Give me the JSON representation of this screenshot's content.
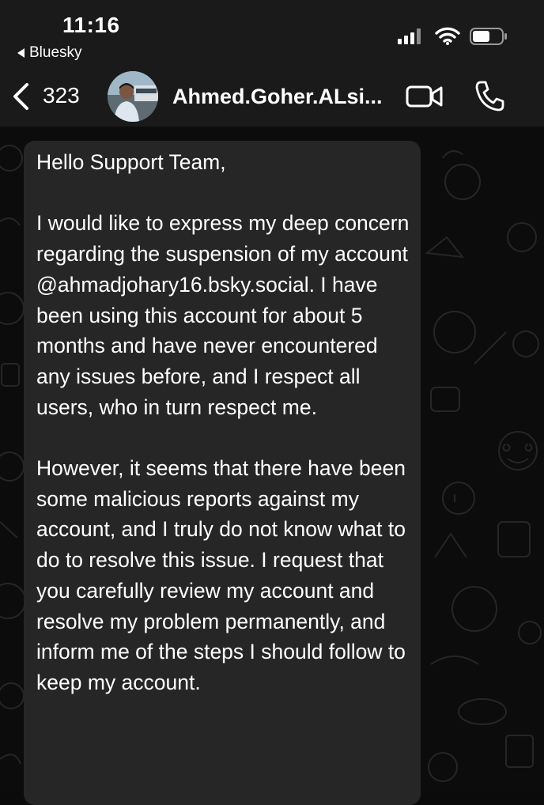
{
  "status_bar": {
    "time": "11:16",
    "back_app": "Bluesky",
    "icons": [
      "signal-bars-icon",
      "wifi-icon",
      "battery-icon"
    ]
  },
  "header": {
    "back_icon": "chevron-left-icon",
    "unread_count": "323",
    "contact_name": "Ahmed.Goher.ALsi...",
    "actions": [
      "video-call-icon",
      "phone-call-icon"
    ]
  },
  "message": {
    "greeting": "Hello Support Team,",
    "paragraph1": "I would like to express my deep concern regarding the suspension of my account @ahmadjohary16.bsky.social. I have been using this account for about 5 months and have never encountered any issues before, and I respect all users, who in turn respect me.",
    "paragraph2": "However, it seems that there have been some malicious reports against my account, and I truly do not know what to do to resolve this issue. I request that you carefully review my account and resolve my problem permanently, and inform me of the steps I should follow to keep my account."
  },
  "colors": {
    "bar_background": "#1a1a1a",
    "chat_background": "#0c0c0c",
    "bubble_background": "#262626",
    "text": "#ffffff"
  }
}
